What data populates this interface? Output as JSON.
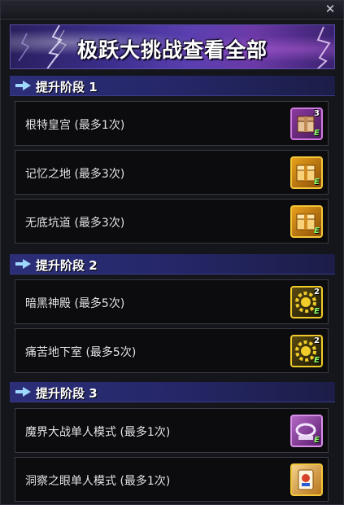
{
  "window": {
    "close_glyph": "✕"
  },
  "banner": {
    "title": "极跃大挑战查看全部"
  },
  "stages": [
    {
      "label": "提升阶段 1",
      "items": [
        {
          "name": "根特皇宫 (最多1次)",
          "icon": "chest-purple-icon",
          "badge": "3"
        },
        {
          "name": "记忆之地 (最多3次)",
          "icon": "chest-gold-icon",
          "badge": ""
        },
        {
          "name": "无底坑道 (最多3次)",
          "icon": "chest-gold-icon",
          "badge": ""
        }
      ]
    },
    {
      "label": "提升阶段 2",
      "items": [
        {
          "name": "暗黑神殿 (最多5次)",
          "icon": "free-gear-icon",
          "badge": "2"
        },
        {
          "name": "痛苦地下室 (最多5次)",
          "icon": "free-gear-icon",
          "badge": "2"
        }
      ]
    },
    {
      "label": "提升阶段 3",
      "items": [
        {
          "name": "魔界大战单人模式 (最多1次)",
          "icon": "ring-purple-icon",
          "badge": ""
        },
        {
          "name": "洞察之眼单人模式 (最多1次)",
          "icon": "ace-card-icon",
          "badge": ""
        }
      ]
    }
  ],
  "ticket_suffix": "E",
  "colors": {
    "stage_bar": "#2c2e78",
    "row_border": "#3a3a44",
    "ticket_gold": "#f3c637",
    "banner_purple": "#5a3fb0"
  }
}
